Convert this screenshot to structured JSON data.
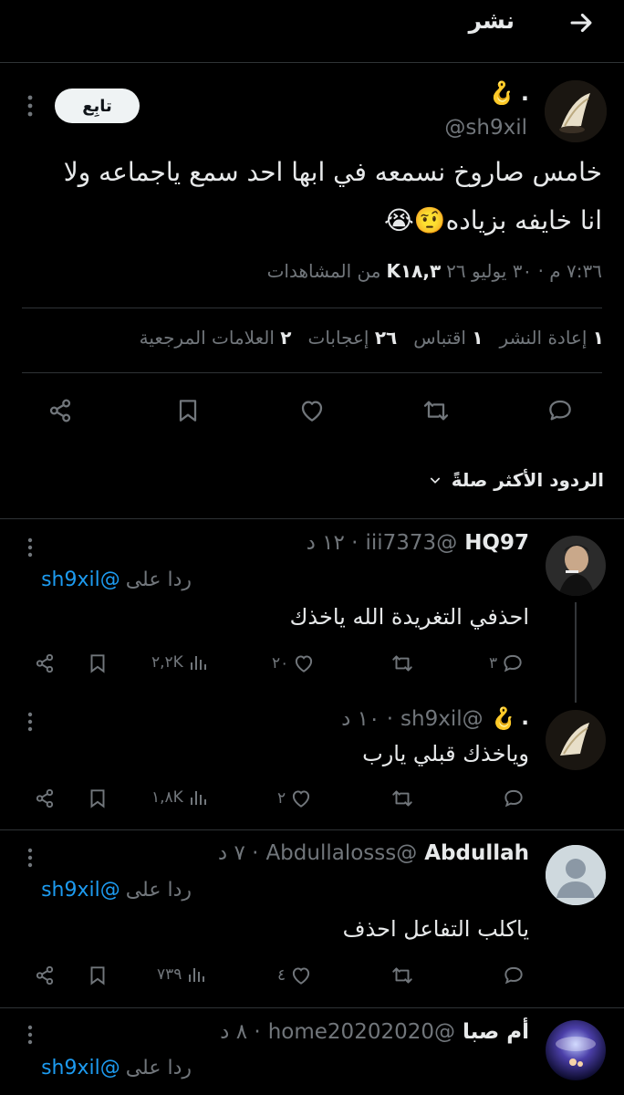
{
  "header": {
    "title": "نشر"
  },
  "post": {
    "display_name": ".",
    "name_emoji": "🪝",
    "handle": "@sh9xil",
    "follow_label": "تابِع",
    "text_line1": "خامس صاروخ نسمعه في ابها احد سمع ياجماعه ولا",
    "text_line2": "انا خايفه بزياده🤨😭",
    "meta_time": "٧:٣٦ م · ٣٠ يوليو ٢٦",
    "meta_views_count": "K١٨,٣",
    "meta_views_label": "من المشاهدات",
    "stats": {
      "reposts_count": "١",
      "reposts_label": "إعادة النشر",
      "quotes_count": "١",
      "quotes_label": "اقتباس",
      "likes_count": "٢٦",
      "likes_label": "إعجابات",
      "bookmarks_count": "٢",
      "bookmarks_label": "العلامات المرجعية"
    }
  },
  "sort": {
    "label": "الردود الأكثر صلةً"
  },
  "replies": [
    {
      "name": "HQ97",
      "handle": "@iii7373",
      "time": "· ١٢ د",
      "replying_prefix": "ردا على",
      "replying_to": "@sh9xil",
      "text": "احذفي التغريدة الله ياخذك",
      "replies_count": "٣",
      "likes_count": "٢٠",
      "views_count": "٢,٢K"
    },
    {
      "name": ".",
      "name_emoji": "🪝",
      "handle": "@sh9xil",
      "time": "· ١٠ د",
      "text": "وياخذك قبلي يارب",
      "likes_count": "٢",
      "views_count": "١,٨K"
    },
    {
      "name": "Abdullah",
      "handle": "@Abdullalosss",
      "time": "· ٧ د",
      "replying_prefix": "ردا على",
      "replying_to": "@sh9xil",
      "text": "ياكلب التفاعل احذف",
      "likes_count": "٤",
      "views_count": "٧٣٩"
    },
    {
      "name": "أم صبا",
      "handle": "@home20202020",
      "time": "· ٨ د",
      "replying_prefix": "ردا على",
      "replying_to": "@sh9xil"
    }
  ],
  "colors": {
    "background": "#000000",
    "text": "#e7e9ea",
    "muted": "#71767b",
    "accent": "#1d9bf0",
    "divider": "#2f3336",
    "emoji_orange": "#f4900c"
  }
}
